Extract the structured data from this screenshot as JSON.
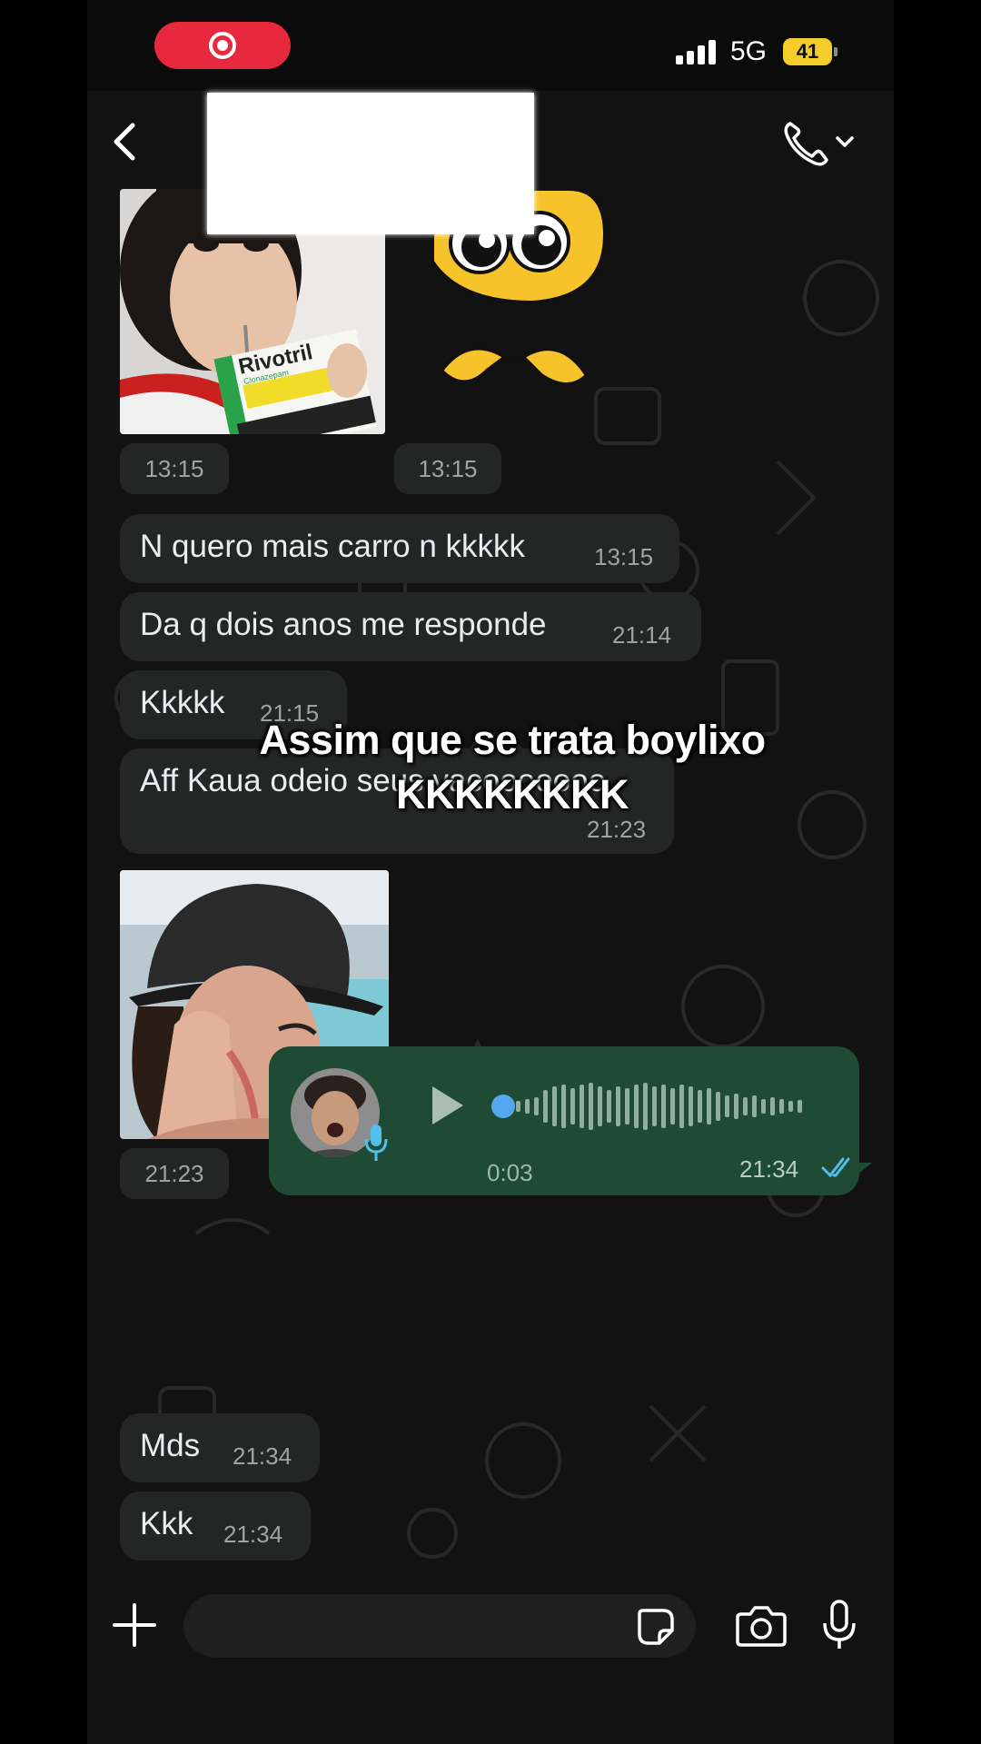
{
  "status_bar": {
    "network": "5G",
    "battery": "41"
  },
  "header": {
    "contact_name": ""
  },
  "messages": [
    {
      "type": "image",
      "time": "13:15"
    },
    {
      "type": "sticker",
      "time": "13:15"
    },
    {
      "type": "text",
      "text": "N quero mais carro n kkkkk",
      "time": "13:15"
    },
    {
      "type": "text",
      "text": "Da q dois anos me responde",
      "time": "21:14"
    },
    {
      "type": "text",
      "text": "Kkkkk",
      "time": "21:15"
    },
    {
      "type": "text",
      "text": "Aff Kaua odeio seus vacooooooo",
      "time": "21:23"
    },
    {
      "type": "image",
      "time": "21:23"
    },
    {
      "type": "voice",
      "duration": "0:03",
      "time": "21:34"
    },
    {
      "type": "text",
      "text": "Mds",
      "time": "21:34"
    },
    {
      "type": "text",
      "text": "Kkk",
      "time": "21:34"
    }
  ],
  "image_texts": {
    "medicine_brand": "Rivotril",
    "medicine_sub": "Clonazepam"
  },
  "overlay": {
    "caption": "Assim que se trata boylixo KKKKKKKK"
  },
  "composer": {
    "placeholder": ""
  },
  "colors": {
    "incoming_bubble": "#242626",
    "outgoing_bubble": "#1f4b34",
    "read_ticks": "#53bdeb",
    "record": "#e8283c",
    "battery": "#f5cd2a"
  },
  "icons": [
    "back-icon",
    "phone-icon",
    "chevron-down-icon",
    "plus-icon",
    "sticker-icon",
    "camera-icon",
    "microphone-icon",
    "play-icon",
    "read-ticks-icon"
  ]
}
